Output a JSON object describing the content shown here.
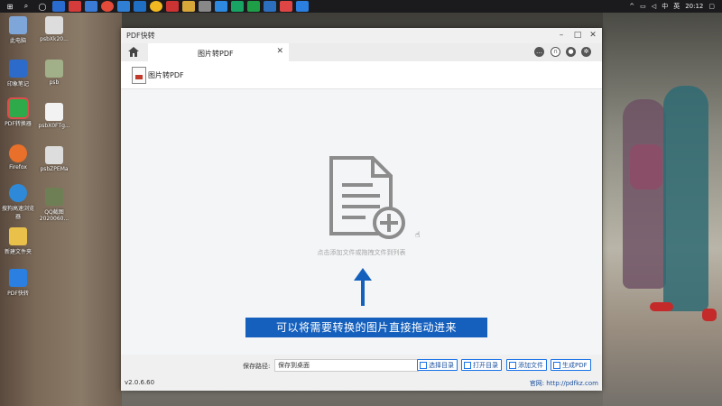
{
  "desktop": {
    "icons": [
      {
        "label": "此电脑",
        "x_ref": "col1"
      },
      {
        "label": "psbXk20...",
        "x_ref": "col2"
      },
      {
        "label": "印象笔记",
        "x_ref": "col1"
      },
      {
        "label": "psb",
        "x_ref": "col2"
      },
      {
        "label": "PDF转换器",
        "x_ref": "col1"
      },
      {
        "label": "psbX0FTg...",
        "x_ref": "col2"
      },
      {
        "label": "Firefox",
        "x_ref": "col1"
      },
      {
        "label": "psbZPEMa",
        "x_ref": "col2"
      },
      {
        "label": "搜狗高速浏览器",
        "x_ref": "col1"
      },
      {
        "label": "QQ截图 2020060...",
        "x_ref": "col2"
      },
      {
        "label": "新建文件夹",
        "x_ref": "col1"
      },
      {
        "label": "PDF快转",
        "x_ref": "col1"
      }
    ]
  },
  "taskbar": {
    "time": "20:12",
    "ime": "中",
    "lang": "英"
  },
  "window": {
    "title": "PDF快转",
    "tab_label": "图片转PDF",
    "header_title": "图片转PDF",
    "drop_hint": "点击添加文件或拖拽文件到列表",
    "caption": "可以将需要转换的图片直接拖动进来",
    "save_label": "保存路径:",
    "save_value": "保存到桌面",
    "buttons": {
      "choose_dir": "选择目录",
      "open_dir": "打开目录",
      "add_file": "添加文件",
      "generate": "生成PDF"
    },
    "version": "v2.0.6.60",
    "website": "官网: http://pdfkz.com"
  },
  "colors": {
    "accent": "#1a73e8",
    "caption_bg": "#1560bd"
  }
}
